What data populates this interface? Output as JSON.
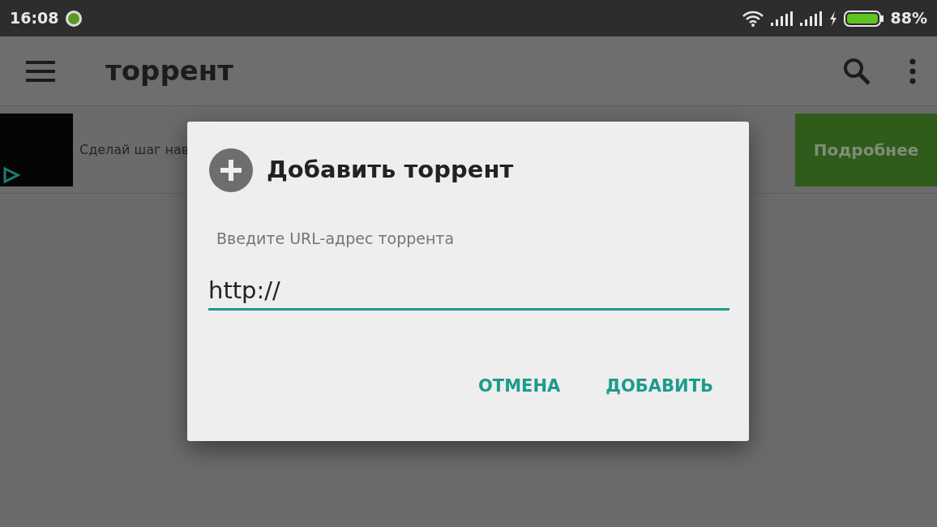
{
  "status_bar": {
    "time": "16:08",
    "battery": "88%"
  },
  "app_bar": {
    "title": "торрент"
  },
  "ad": {
    "text": "Сделай шаг нав",
    "button": "Подробнее"
  },
  "dialog": {
    "title": "Добавить торрент",
    "label": "Введите URL-адрес торрента",
    "value": "http://",
    "buttons": [
      "ОТМЕНА",
      "ДОБАВИТЬ"
    ]
  }
}
